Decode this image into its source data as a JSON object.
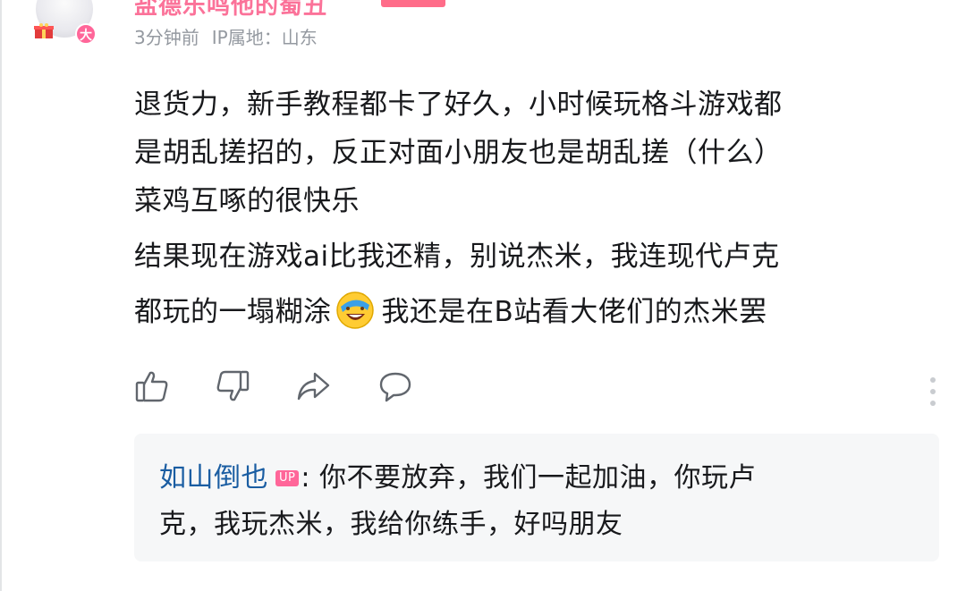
{
  "comment": {
    "username": "盐德乐鸣他的蜀丑",
    "level_badge": "大",
    "time": "3分钟前",
    "ip_location": "IP属地：山东",
    "lines": [
      "退货力，新手教程都卡了好久，小时候玩格斗游戏都",
      "是胡乱搓招的，反正对面小朋友也是胡乱搓（什么）",
      "菜鸡互啄的很快乐",
      "结果现在游戏ai比我还精，别说杰米，我连现代卢克"
    ],
    "last_line_before_emoji": "都玩的一塌糊涂",
    "last_line_after_emoji": "我还是在B站看大佬们的杰米罢",
    "emoji": "laughing-crying-emoji"
  },
  "actions": {
    "icons": [
      "thumbs-up-icon",
      "thumbs-down-icon",
      "share-icon",
      "comment-icon",
      "more-vertical-icon"
    ]
  },
  "reply": {
    "username": "如山倒也",
    "badge": "UP",
    "separator": ":",
    "text_line1": "你不要放弃，我们一起加油，你玩卢",
    "text_line2": "克，我玩杰米，我给你练手，好吗朋友"
  },
  "colors": {
    "username": "#fb7299",
    "meta": "#9499a0",
    "reply_user": "#1a5da2",
    "reply_bg": "#f6f7f8",
    "icon": "#61666d"
  }
}
